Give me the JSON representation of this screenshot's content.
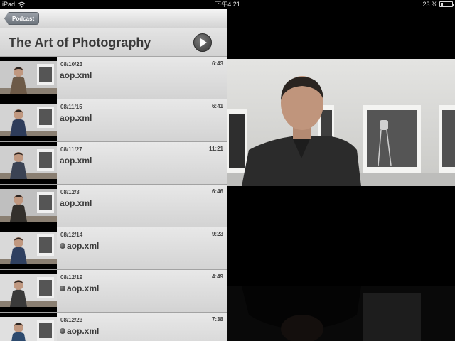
{
  "status_bar": {
    "device": "iPad",
    "time": "下午4:21",
    "battery": "23 %",
    "battery_level": 0.23
  },
  "nav": {
    "back_label": "Podcast"
  },
  "header": {
    "title": "The Art of Photography"
  },
  "episodes": [
    {
      "date": "08/10/23",
      "duration": "6:43",
      "name": "aop.xml",
      "unplayed": false
    },
    {
      "date": "08/11/15",
      "duration": "6:41",
      "name": "aop.xml",
      "unplayed": false
    },
    {
      "date": "08/11/27",
      "duration": "11:21",
      "name": "aop.xml",
      "unplayed": false
    },
    {
      "date": "08/12/3",
      "duration": "6:46",
      "name": "aop.xml",
      "unplayed": false
    },
    {
      "date": "08/12/14",
      "duration": "9:23",
      "name": "aop.xml",
      "unplayed": true
    },
    {
      "date": "08/12/19",
      "duration": "4:49",
      "name": "aop.xml",
      "unplayed": true
    },
    {
      "date": "08/12/23",
      "duration": "7:38",
      "name": "aop.xml",
      "unplayed": true
    }
  ],
  "icons": {
    "wifi": "wifi-icon",
    "battery": "battery-icon",
    "play": "play-icon",
    "new_dot": "new-dot-icon"
  },
  "colors": {
    "panel_bg": "#d9d9d9",
    "title_text": "#3a3a3a",
    "back_button": "#7f868e"
  }
}
